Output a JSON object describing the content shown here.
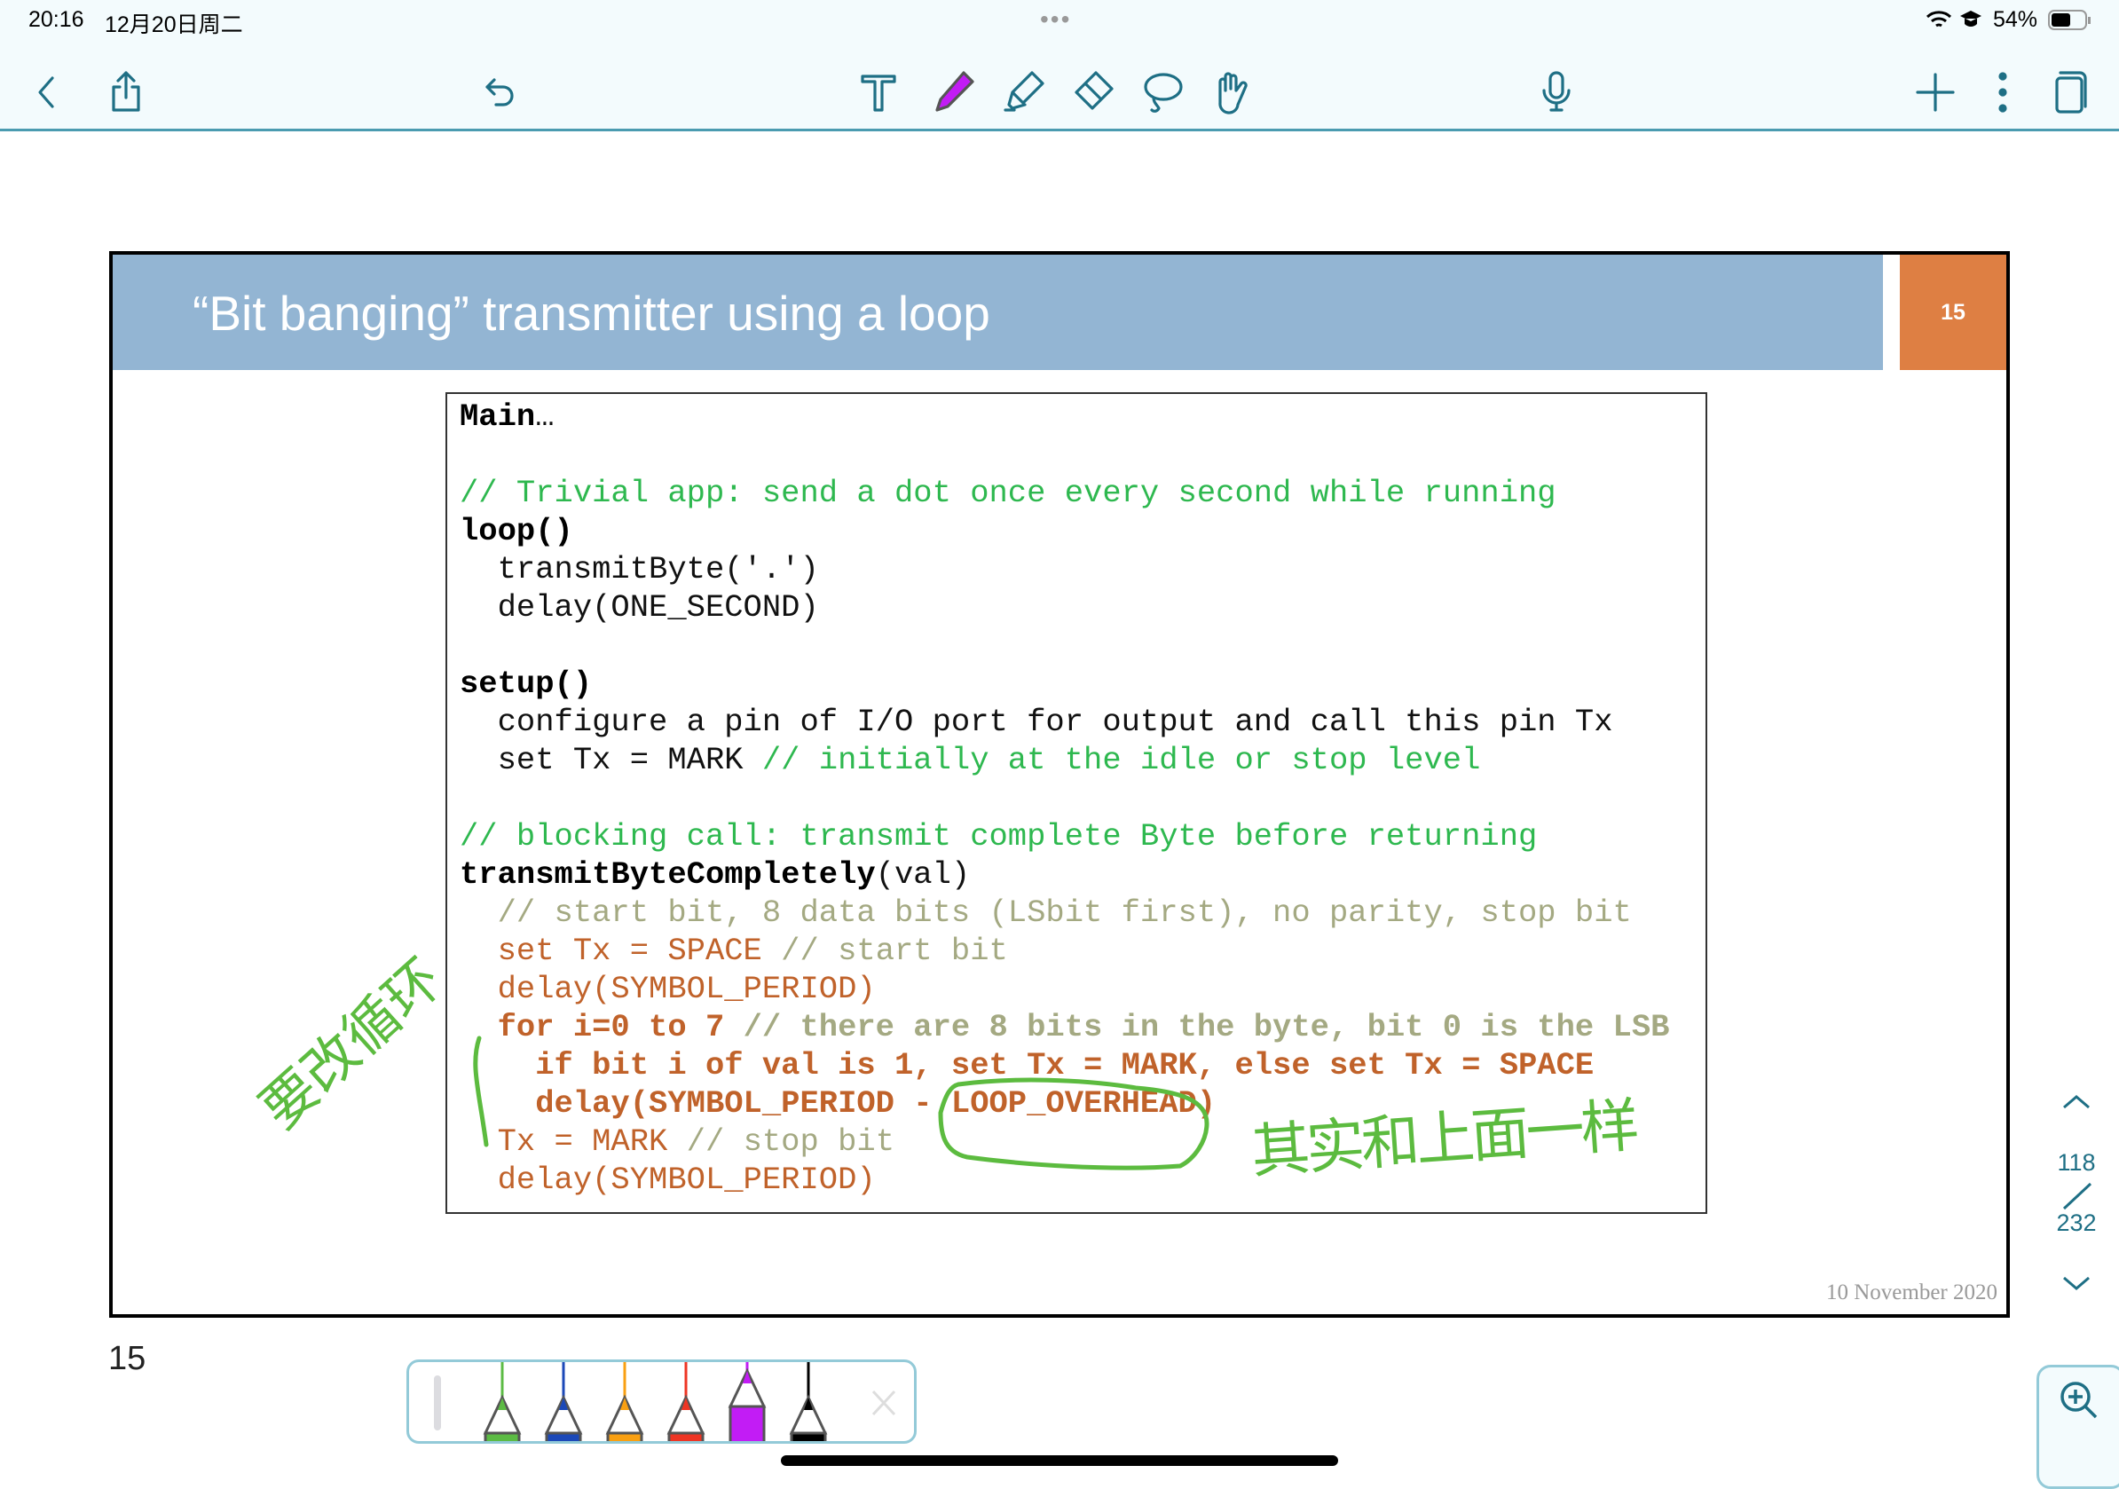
{
  "status": {
    "time": "20:16",
    "date": "12月20日周二",
    "battery": "54%",
    "icons": [
      "wifi-icon",
      "vpn-icon",
      "battery-icon"
    ]
  },
  "toolbar": {
    "icons": [
      "back-icon",
      "share-icon",
      "undo-icon",
      "text-icon",
      "pen-icon",
      "highlighter-icon",
      "eraser-icon",
      "lasso-icon",
      "hand-icon",
      "microphone-icon",
      "add-page-icon",
      "more-icon",
      "pages-icon"
    ],
    "active_tool": "pen",
    "accent": "#1e6f85",
    "pen_color": "#c21cf5"
  },
  "slide": {
    "title": "“Bit banging” transmitter using a loop",
    "number": "15",
    "date": "10 November 2020",
    "colors": {
      "band": "#93b5d3",
      "number_box": "#de7f43"
    },
    "code": [
      [
        {
          "t": "Main",
          "s": "k"
        },
        {
          "t": "…",
          "s": "n"
        }
      ],
      [],
      [
        {
          "t": "// Trivial app: send a dot once every second while running",
          "s": "g"
        }
      ],
      [
        {
          "t": "loop",
          "s": "k"
        },
        {
          "t": "()",
          "s": "k"
        }
      ],
      [
        {
          "t": "  transmitByte('.')",
          "s": "n"
        }
      ],
      [
        {
          "t": "  delay(ONE_SECOND)",
          "s": "n"
        }
      ],
      [],
      [
        {
          "t": "setup()",
          "s": "k"
        }
      ],
      [
        {
          "t": "  configure a pin of I/O port for output and call this pin Tx",
          "s": "n"
        }
      ],
      [
        {
          "t": "  set Tx = MARK ",
          "s": "n"
        },
        {
          "t": "// initially at the idle or stop level",
          "s": "g"
        }
      ],
      [],
      [
        {
          "t": "// blocking call: transmit complete Byte before returning",
          "s": "g"
        }
      ],
      [
        {
          "t": "transmitByteCompletely",
          "s": "k"
        },
        {
          "t": "(val)",
          "s": "n"
        }
      ],
      [
        {
          "t": "  // start bit, 8 data bits (LSbit first), no parity, stop bit",
          "s": "c"
        }
      ],
      [
        {
          "t": "  set Tx = SPACE ",
          "s": "o"
        },
        {
          "t": "// start bit",
          "s": "c"
        }
      ],
      [
        {
          "t": "  delay(SYMBOL_PERIOD)",
          "s": "o"
        }
      ],
      [
        {
          "t": "  for i=0 to 7 ",
          "s": "ob"
        },
        {
          "t": "// there are 8 bits in the byte, bit 0 is the LSB",
          "s": "cb"
        }
      ],
      [
        {
          "t": "    if bit i of val is 1, set Tx = MARK, else set Tx = SPACE",
          "s": "ob"
        }
      ],
      [
        {
          "t": "    delay(SYMBOL_PERIOD - LOOP_OVERHEAD)",
          "s": "ob"
        }
      ],
      [
        {
          "t": "  Tx = MARK ",
          "s": "o"
        },
        {
          "t": "// stop bit",
          "s": "c"
        }
      ],
      [
        {
          "t": "  delay(SYMBOL_PERIOD)",
          "s": "o"
        }
      ]
    ],
    "syntax_colors": {
      "k": "#000000",
      "n": "#111111",
      "g": "#2eb84f",
      "o": "#c0622a",
      "c": "#a4a982"
    }
  },
  "annotations": {
    "color": "#5cbb3f",
    "handwritten": [
      "要改循环",
      "其实和上面一样"
    ]
  },
  "page_label": "15",
  "navigator": {
    "current": "118",
    "total": "232",
    "up_icon": "chevron-up-icon",
    "down_icon": "chevron-down-icon"
  },
  "pen_tray": {
    "pens": [
      {
        "color": "#5cbb44"
      },
      {
        "color": "#1c49b8"
      },
      {
        "color": "#f9a012"
      },
      {
        "color": "#ee3524"
      },
      {
        "color": "#c21cf5",
        "selected": true
      },
      {
        "color": "#000000"
      }
    ]
  },
  "zoom_icon": "zoom-in-icon"
}
